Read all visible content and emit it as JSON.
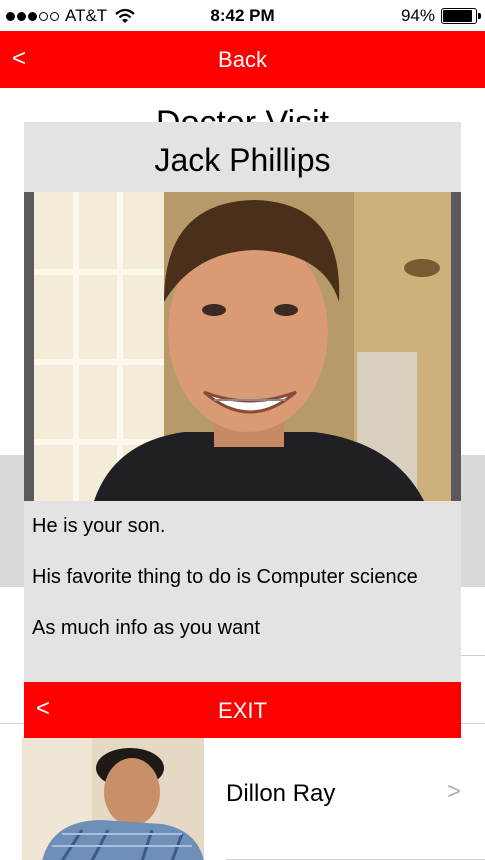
{
  "status_bar": {
    "carrier": "AT&T",
    "signal_bars_filled": 3,
    "signal_bars_total": 5,
    "time": "8:42 PM",
    "battery_percent_text": "94%",
    "battery_level": 0.94
  },
  "nav": {
    "back_chevron": "<",
    "back_label": "Back",
    "color": "#ff0000"
  },
  "page": {
    "title": "Doctor Visit"
  },
  "modal": {
    "name": "Jack Phillips",
    "photo_icon": "person-photo",
    "lines": [
      "He is your son.",
      "His favorite thing to do is Computer science",
      "As much info as you want"
    ],
    "exit_chevron": "<",
    "exit_label": "EXIT"
  },
  "list": {
    "rows": [
      {
        "name": "Dillon Ray",
        "chevron": ">"
      }
    ]
  }
}
